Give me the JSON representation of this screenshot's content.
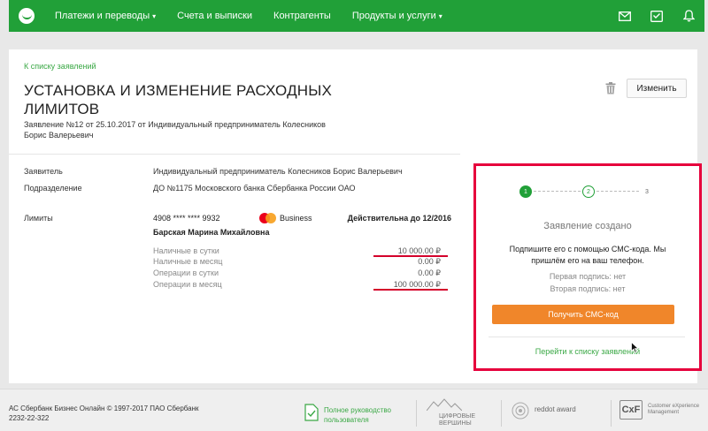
{
  "nav": {
    "items": [
      {
        "label": "Платежи и переводы",
        "dropdown": true
      },
      {
        "label": "Счета и выписки",
        "dropdown": false
      },
      {
        "label": "Контрагенты",
        "dropdown": false
      },
      {
        "label": "Продукты и услуги",
        "dropdown": true
      }
    ],
    "caret": "▾",
    "icons": [
      "mail-icon",
      "inbox-icon",
      "bell-icon"
    ]
  },
  "page": {
    "back_link": "К списку заявлений",
    "title": "УСТАНОВКА И ИЗМЕНЕНИЕ РАСХОДНЫХ ЛИМИТОВ",
    "subtitle": "Заявление №12 от 25.10.2017 от Индивидуальный предприниматель Колесников Борис Валерьевич",
    "edit_button": "Изменить"
  },
  "details": {
    "applicant_label": "Заявитель",
    "applicant_value": "Индивидуальный предприниматель Колесников Борис Валерьевич",
    "division_label": "Подразделение",
    "division_value": "ДО №1175 Московского банка Сбербанка России ОАО",
    "limits_label": "Лимиты"
  },
  "card": {
    "number": "4908 **** **** 9932",
    "type": "Business",
    "valid": "Действительна до 12/2016",
    "holder": "Барская Марина Михайловна",
    "limits": [
      {
        "name": "Наличные в сутки",
        "value": "10 000.00 ₽",
        "underlined": true
      },
      {
        "name": "Наличные в месяц",
        "value": "0.00 ₽",
        "underlined": false
      },
      {
        "name": "Операции в сутки",
        "value": "0.00 ₽",
        "underlined": false
      },
      {
        "name": "Операции в месяц",
        "value": "100 000.00 ₽",
        "underlined": true
      }
    ]
  },
  "sign_panel": {
    "steps": [
      "1",
      "2",
      "3"
    ],
    "status": "Заявление создано",
    "message": "Подпишите его с помощью СМС-кода. Мы пришлём его на ваш телефон.",
    "first_signature": "Первая подпись: нет",
    "second_signature": "Вторая подпись: нет",
    "sms_button": "Получить СМС-код",
    "list_link": "Перейти к списку заявлений"
  },
  "footer": {
    "copyright": "АС Сбербанк Бизнес Онлайн © 1997-2017 ПАО Сбербанк",
    "phone": "2232-22-322",
    "guide": "Полное руководство пользователя",
    "award1": "ЦИФРОВЫЕ ВЕРШИНЫ",
    "award2": "reddot award",
    "award3_logo": "CxF",
    "award3": "Customer eXperience Management"
  },
  "colors": {
    "brand_green": "#21a038",
    "link_green": "#3aa845",
    "button_orange": "#f0862a",
    "highlight_red": "#e6003c"
  }
}
